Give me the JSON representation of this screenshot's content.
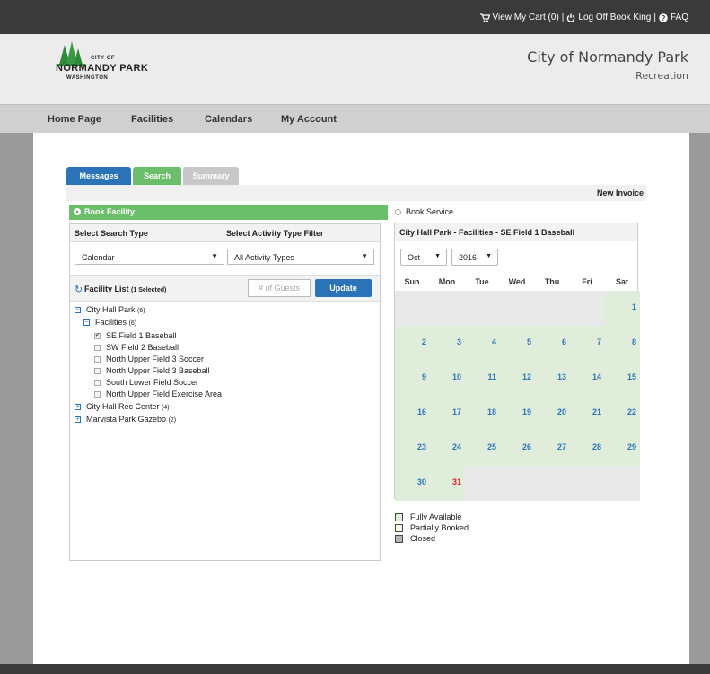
{
  "topbar": {
    "cart_label": "View My Cart (0)",
    "sep1": "|",
    "logoff_label": "Log Off Book King",
    "sep2": "|",
    "faq_label": "FAQ"
  },
  "logo": {
    "city_of": "CITY OF",
    "name": "NORMANDY PARK",
    "state": "WASHINGTON"
  },
  "site": {
    "title": "City of Normandy Park",
    "subtitle": "Recreation"
  },
  "nav": {
    "items": [
      "Home Page",
      "Facilities",
      "Calendars",
      "My Account"
    ]
  },
  "tabs": [
    {
      "label": "Messages",
      "color": "#2b73b7"
    },
    {
      "label": "Search",
      "color": "#6cbf6a"
    },
    {
      "label": "Summary",
      "color": "#c8c8c8"
    }
  ],
  "invoice": {
    "label": "New Invoice"
  },
  "book_facility": {
    "label": "Book Facility"
  },
  "book_service": {
    "label": "Book Service"
  },
  "search": {
    "search_type_header": "Select Search Type",
    "activity_filter_header": "Select Activity Type Filter",
    "search_type_value": "Calendar",
    "activity_filter_value": "All Activity Types"
  },
  "facility_list": {
    "title": "Facility List",
    "selected_note": "(1 Selected)",
    "guests_placeholder": "# of Guests",
    "update_label": "Update",
    "tree": [
      {
        "label": "City Hall Park",
        "count": "(6)",
        "expanded": true
      },
      {
        "label": "Facilities",
        "count": "(6)",
        "expanded": true
      },
      {
        "label": "SE Field 1 Baseball",
        "checked": true
      },
      {
        "label": "SW Field 2 Baseball",
        "checked": false
      },
      {
        "label": "North Upper Field 3 Soccer",
        "checked": false
      },
      {
        "label": "North Upper Field 3 Baseball",
        "checked": false
      },
      {
        "label": "South Lower Field Soccer",
        "checked": false
      },
      {
        "label": "North Upper Field Exercise Area",
        "checked": false
      },
      {
        "label": "City Hall Rec Center",
        "count": "(4)",
        "expanded": false
      },
      {
        "label": "Marvista Park Gazebo",
        "count": "(2)",
        "expanded": false
      }
    ]
  },
  "calendar": {
    "title": "City Hall Park - Facilities - SE Field 1 Baseball",
    "month": "Oct",
    "year": "2016",
    "days_of_week": [
      "Sun",
      "Mon",
      "Tue",
      "Wed",
      "Thu",
      "Fri",
      "Sat"
    ],
    "weeks": [
      [
        "",
        "",
        "",
        "",
        "",
        "",
        "1"
      ],
      [
        "2",
        "3",
        "4",
        "5",
        "6",
        "7",
        "8"
      ],
      [
        "9",
        "10",
        "11",
        "12",
        "13",
        "14",
        "15"
      ],
      [
        "16",
        "17",
        "18",
        "19",
        "20",
        "21",
        "22"
      ],
      [
        "23",
        "24",
        "25",
        "26",
        "27",
        "28",
        "29"
      ],
      [
        "30",
        "31",
        "",
        "",
        "",
        "",
        ""
      ]
    ],
    "today": "31",
    "available_color": "#e1eddb",
    "empty_color": "#e9e9e9",
    "today_color": "#d12a2a"
  },
  "legend": {
    "items": [
      {
        "label": "Fully Available",
        "color": "#e1eddb"
      },
      {
        "label": "Partially Booked",
        "color": "#fdf8e4"
      },
      {
        "label": "Closed",
        "color": "#b5b5b5"
      }
    ]
  }
}
